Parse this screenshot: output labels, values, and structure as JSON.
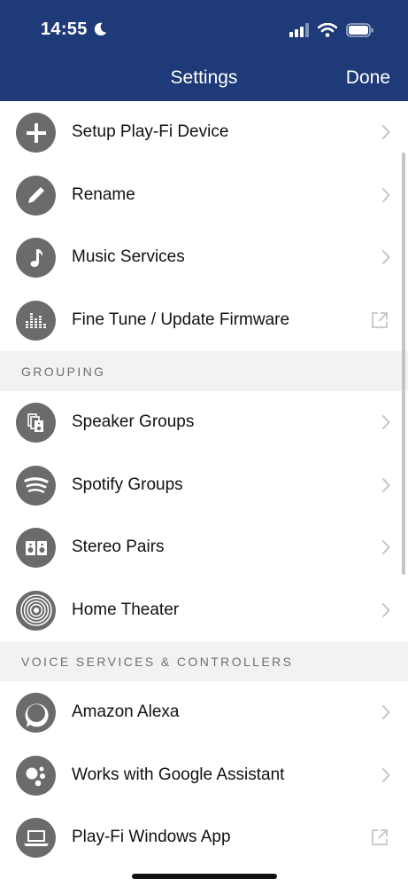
{
  "status_bar": {
    "time": "14:55"
  },
  "nav": {
    "title": "Settings",
    "done_label": "Done"
  },
  "items_main": [
    {
      "label": "Setup Play-Fi Device",
      "icon": "plus-icon",
      "action": "chevron"
    },
    {
      "label": "Rename",
      "icon": "pencil-icon",
      "action": "chevron"
    },
    {
      "label": "Music Services",
      "icon": "music-note-icon",
      "action": "chevron"
    },
    {
      "label": "Fine Tune / Update Firmware",
      "icon": "equalizer-icon",
      "action": "external-link"
    }
  ],
  "section_grouping": {
    "title": "GROUPING"
  },
  "items_grouping": [
    {
      "label": "Speaker Groups",
      "icon": "speaker-group-icon",
      "action": "chevron"
    },
    {
      "label": "Spotify Groups",
      "icon": "spotify-icon",
      "action": "chevron"
    },
    {
      "label": "Stereo Pairs",
      "icon": "stereo-pair-icon",
      "action": "chevron"
    },
    {
      "label": "Home Theater",
      "icon": "home-theater-icon",
      "action": "chevron"
    }
  ],
  "section_voice": {
    "title": "VOICE SERVICES & CONTROLLERS"
  },
  "items_voice": [
    {
      "label": "Amazon Alexa",
      "icon": "alexa-icon",
      "action": "chevron"
    },
    {
      "label": "Works with Google Assistant",
      "icon": "google-assistant-icon",
      "action": "chevron"
    },
    {
      "label": "Play-Fi Windows App",
      "icon": "laptop-icon",
      "action": "external-link"
    }
  ],
  "colors": {
    "header": "#1f3a78",
    "icon_bg": "#6b6b6b",
    "section_bg": "#f2f2f3"
  }
}
